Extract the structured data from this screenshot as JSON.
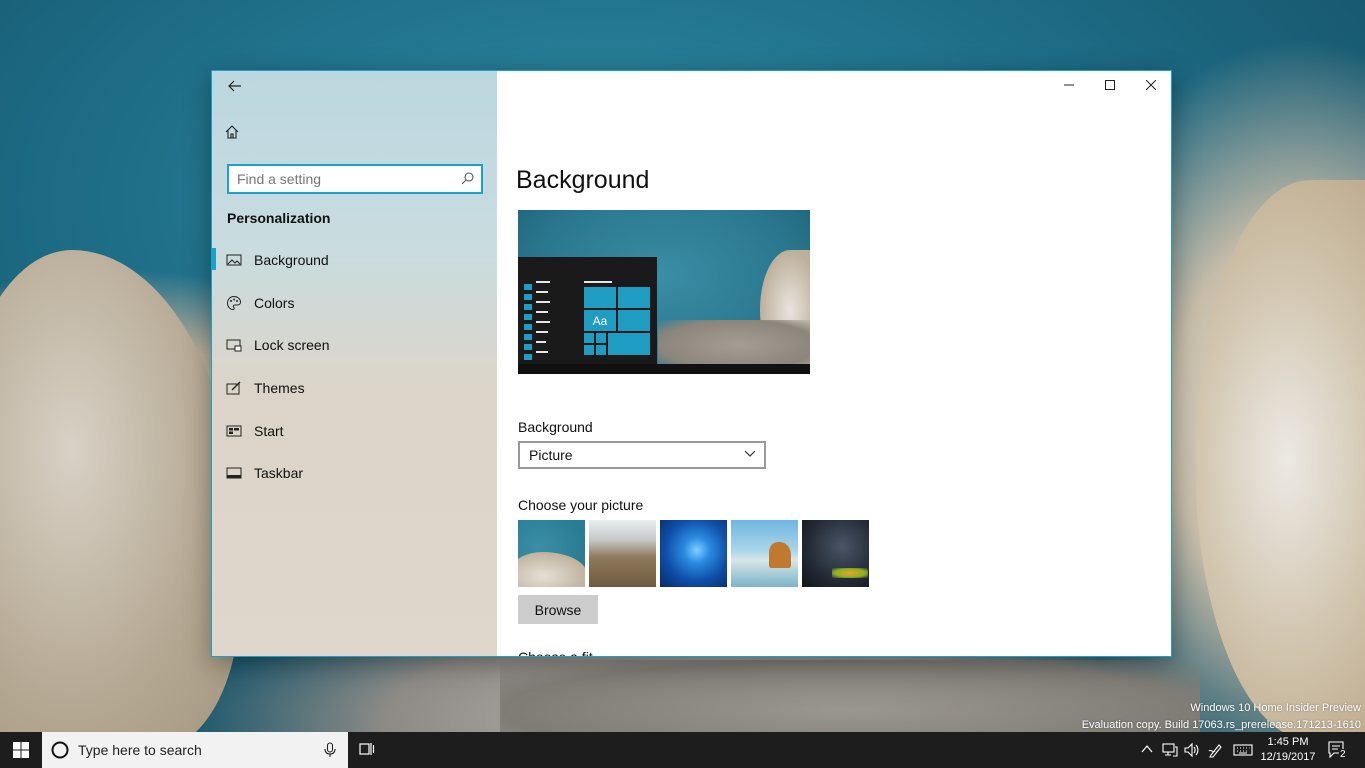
{
  "desktop": {
    "watermark_line1": "Windows 10 Home Insider Preview",
    "watermark_line2": "Evaluation copy. Build 17063.rs_prerelease.171213-1610"
  },
  "window": {
    "accent_color": "#1aa2c8",
    "sidebar": {
      "search_placeholder": "Find a setting",
      "section_title": "Personalization",
      "items": [
        {
          "label": "Background",
          "icon": "picture-icon",
          "selected": true
        },
        {
          "label": "Colors",
          "icon": "palette-icon",
          "selected": false
        },
        {
          "label": "Lock screen",
          "icon": "lock-screen-icon",
          "selected": false
        },
        {
          "label": "Themes",
          "icon": "themes-icon",
          "selected": false
        },
        {
          "label": "Start",
          "icon": "start-icon",
          "selected": false
        },
        {
          "label": "Taskbar",
          "icon": "taskbar-icon",
          "selected": false
        }
      ]
    },
    "content": {
      "page_title": "Background",
      "preview_tile_text": "Aa",
      "background_label": "Background",
      "background_value": "Picture",
      "choose_label": "Choose your picture",
      "browse_label": "Browse",
      "cut_off_label": "Choose a fit"
    }
  },
  "taskbar": {
    "search_text": "Type here to search",
    "time": "1:45 PM",
    "date": "12/19/2017",
    "notification_count": "2"
  }
}
